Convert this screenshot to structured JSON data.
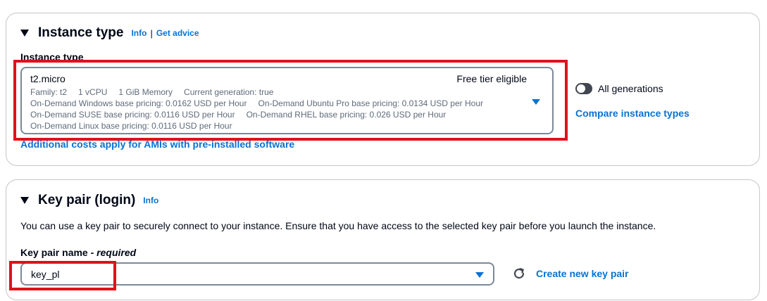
{
  "instance_type_section": {
    "title": "Instance type",
    "info_label": "Info",
    "separator": "|",
    "get_advice_label": "Get advice",
    "field_label": "Instance type",
    "selected": {
      "name": "t2.micro",
      "badge": "Free tier eligible",
      "family": "Family: t2",
      "vcpu": "1 vCPU",
      "memory": "1 GiB Memory",
      "current_generation": "Current generation: true",
      "windows_pricing": "On-Demand Windows base pricing: 0.0162 USD per Hour",
      "ubuntu_pro_pricing": "On-Demand Ubuntu Pro base pricing: 0.0134 USD per Hour",
      "suse_pricing": "On-Demand SUSE base pricing: 0.0116 USD per Hour",
      "rhel_pricing": "On-Demand RHEL base pricing: 0.026 USD per Hour",
      "linux_pricing": "On-Demand Linux base pricing: 0.0116 USD per Hour"
    },
    "all_generations_label": "All generations",
    "compare_link": "Compare instance types",
    "ami_costs_link": "Additional costs apply for AMIs with pre-installed software"
  },
  "key_pair_section": {
    "title": "Key pair (login)",
    "info_label": "Info",
    "description": "You can use a key pair to securely connect to your instance. Ensure that you have access to the selected key pair before you launch the instance.",
    "field_label": "Key pair name - ",
    "required_label": "required",
    "selected_value": "key_pl",
    "create_link": "Create new key pair"
  },
  "colors": {
    "link": "#0972d3",
    "highlight": "#e0111b",
    "text": "#000716",
    "secondary_text": "#5f6b7a"
  }
}
